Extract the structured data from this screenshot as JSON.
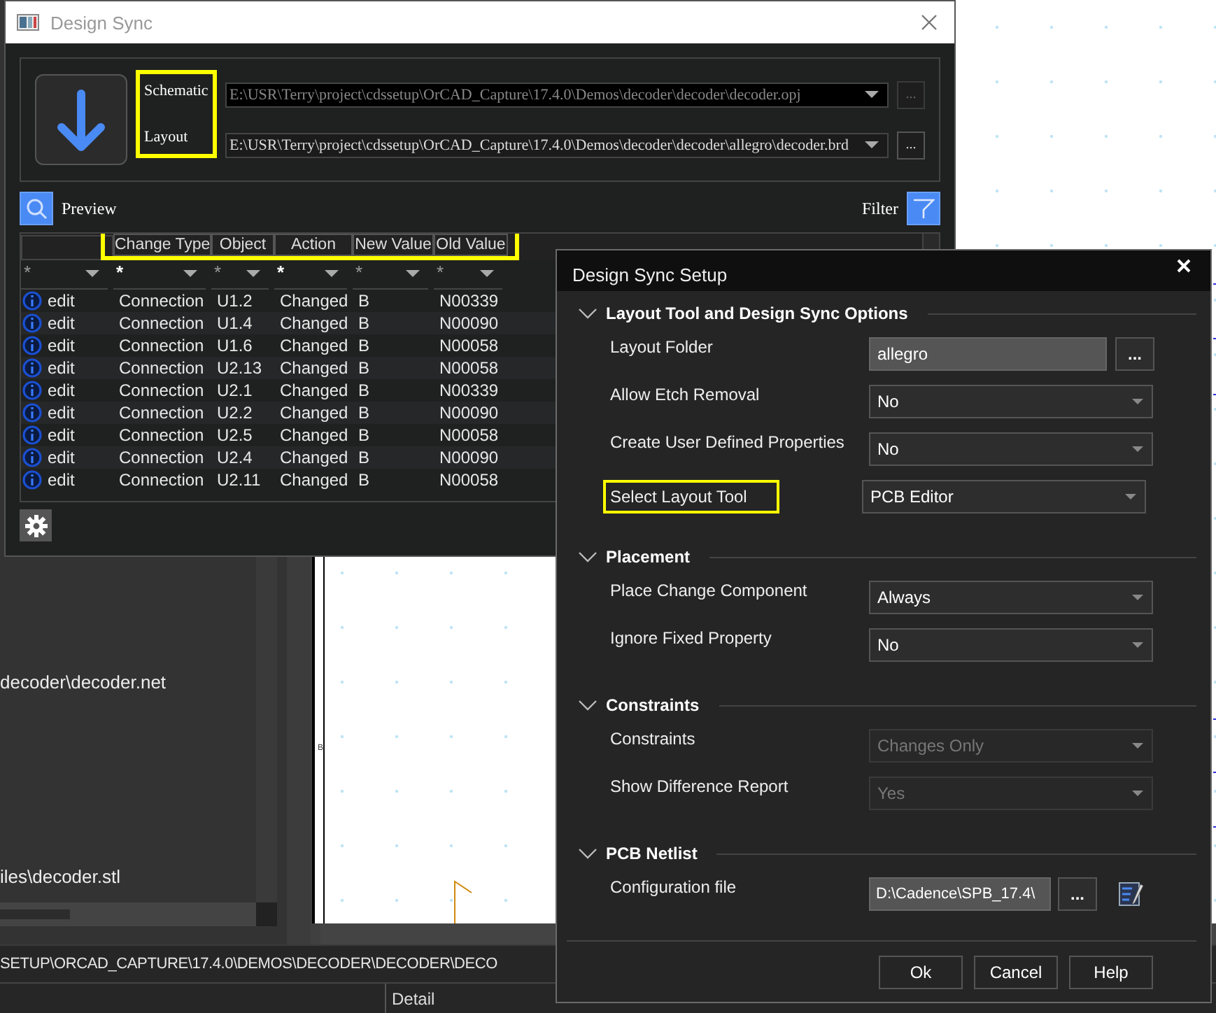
{
  "background_app": {
    "project_items": [
      "decoder\\decoder.net",
      "iles\\decoder.stl"
    ],
    "canvas_label": "B",
    "status_path": "SETUP\\ORCAD_CAPTURE\\17.4.0\\DEMOS\\DECODER\\DECODER\\DECO",
    "bottom_columns": [
      "Detail"
    ]
  },
  "design_sync": {
    "title": "Design Sync",
    "files": [
      {
        "label": "Schematic",
        "value": "E:\\USR\\Terry\\project\\cdssetup\\OrCAD_Capture\\17.4.0\\Demos\\decoder\\decoder\\decoder.opj",
        "button": "...",
        "disabled": true
      },
      {
        "label": "Layout",
        "value": "E:\\USR\\Terry\\project\\cdssetup\\OrCAD_Capture\\17.4.0\\Demos\\decoder\\decoder\\allegro\\decoder.brd",
        "button": "...",
        "disabled": false
      }
    ],
    "labels_highlighted": true,
    "preview_label": "Preview",
    "filter_label": "Filter",
    "table": {
      "columns": [
        "",
        "Change Type",
        "Object",
        "Action",
        "New Value",
        "Old Value"
      ],
      "header_highlighted": true,
      "filters": [
        {
          "text": "*",
          "active": false
        },
        {
          "text": "*",
          "active": true
        },
        {
          "text": "*",
          "active": false
        },
        {
          "text": "*",
          "active": true
        },
        {
          "text": "*",
          "active": false
        },
        {
          "text": "*",
          "active": false
        }
      ],
      "rows": [
        {
          "cells": [
            "edit",
            "Connection",
            "U1.2",
            "Changed",
            "B",
            "N00339"
          ]
        },
        {
          "cells": [
            "edit",
            "Connection",
            "U1.4",
            "Changed",
            "B",
            "N00090"
          ]
        },
        {
          "cells": [
            "edit",
            "Connection",
            "U1.6",
            "Changed",
            "B",
            "N00058"
          ]
        },
        {
          "cells": [
            "edit",
            "Connection",
            "U2.13",
            "Changed",
            "B",
            "N00058"
          ]
        },
        {
          "cells": [
            "edit",
            "Connection",
            "U2.1",
            "Changed",
            "B",
            "N00339"
          ]
        },
        {
          "cells": [
            "edit",
            "Connection",
            "U2.2",
            "Changed",
            "B",
            "N00090"
          ]
        },
        {
          "cells": [
            "edit",
            "Connection",
            "U2.5",
            "Changed",
            "B",
            "N00058"
          ]
        },
        {
          "cells": [
            "edit",
            "Connection",
            "U2.4",
            "Changed",
            "B",
            "N00090"
          ]
        },
        {
          "cells": [
            "edit",
            "Connection",
            "U2.11",
            "Changed",
            "B",
            "N00058"
          ]
        }
      ]
    }
  },
  "setup_dialog": {
    "title": "Design Sync Setup",
    "sections": [
      {
        "title": "Layout Tool and Design Sync Options",
        "expanded": true,
        "rows": [
          {
            "kind": "text",
            "label": "Layout Folder",
            "value": "allegro",
            "button": "...",
            "disabled": false,
            "highlighted": false
          },
          {
            "kind": "dropdown",
            "label": "Allow Etch Removal",
            "value": "No",
            "disabled": false,
            "highlighted": false
          },
          {
            "kind": "dropdown",
            "label": "Create User Defined Properties",
            "value": "No",
            "disabled": false,
            "highlighted": false
          },
          {
            "kind": "dropdown",
            "label": "Select Layout Tool",
            "value": "PCB Editor",
            "disabled": false,
            "highlighted": true
          }
        ]
      },
      {
        "title": "Placement",
        "expanded": true,
        "rows": [
          {
            "kind": "dropdown",
            "label": "Place Change Component",
            "value": "Always",
            "disabled": false,
            "highlighted": false
          },
          {
            "kind": "dropdown",
            "label": "Ignore Fixed Property",
            "value": "No",
            "disabled": false,
            "highlighted": false
          }
        ]
      },
      {
        "title": "Constraints",
        "expanded": true,
        "rows": [
          {
            "kind": "dropdown",
            "label": "Constraints",
            "value": "Changes Only",
            "disabled": true,
            "highlighted": false
          },
          {
            "kind": "dropdown",
            "label": "Show Difference Report",
            "value": "Yes",
            "disabled": true,
            "highlighted": false
          }
        ]
      },
      {
        "title": "PCB Netlist",
        "expanded": true,
        "rows": [
          {
            "kind": "file",
            "label": "Configuration file",
            "value": "D:\\Cadence\\SPB_17.4\\",
            "button": "...",
            "disabled": false,
            "highlighted": false
          }
        ]
      }
    ],
    "buttons": [
      "Ok",
      "Cancel",
      "Help"
    ]
  }
}
